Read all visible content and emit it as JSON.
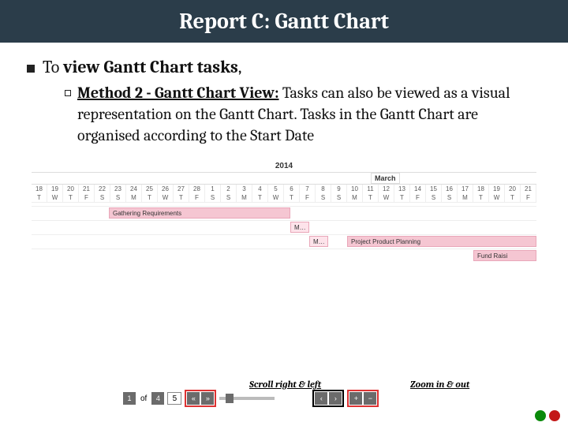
{
  "title": "Report C: Gantt Chart",
  "bullet": {
    "prefix": "To ",
    "emph": "view Gantt Chart tasks",
    "suffix": ","
  },
  "sub": {
    "heading": "Method 2 - Gantt Chart View:",
    "rest": " Tasks can also be viewed as a visual representation on the Gantt Chart. Tasks in the Gantt Chart are organised according to the Start Date"
  },
  "gantt": {
    "year": "2014",
    "month": "March",
    "days": [
      "18",
      "19",
      "20",
      "21",
      "22",
      "23",
      "24",
      "25",
      "26",
      "27",
      "28",
      "1",
      "2",
      "3",
      "4",
      "5",
      "6",
      "7",
      "8",
      "9",
      "10",
      "11",
      "12",
      "13",
      "14",
      "15",
      "16",
      "17",
      "18",
      "19",
      "20",
      "21"
    ],
    "dow": [
      "T",
      "W",
      "T",
      "F",
      "S",
      "S",
      "M",
      "T",
      "W",
      "T",
      "F",
      "S",
      "S",
      "M",
      "T",
      "W",
      "T",
      "F",
      "S",
      "S",
      "M",
      "T",
      "W",
      "T",
      "F",
      "S",
      "S",
      "M",
      "T",
      "W",
      "T",
      "F"
    ],
    "bars": {
      "gathering": "Gathering Requirements",
      "m1": "M…",
      "project_planning": "Project Product Planning",
      "m2": "M…",
      "fund_raise": "Fund Raisi"
    }
  },
  "annotations": {
    "scroll": "Scroll right & left",
    "zoom": "Zoom in & out"
  },
  "pager": {
    "page": "1",
    "of": "of",
    "total": "4",
    "rows_select": "5",
    "prev": "‹",
    "next": "›",
    "first": "«",
    "last": "»",
    "plus": "+",
    "minus": "−"
  }
}
